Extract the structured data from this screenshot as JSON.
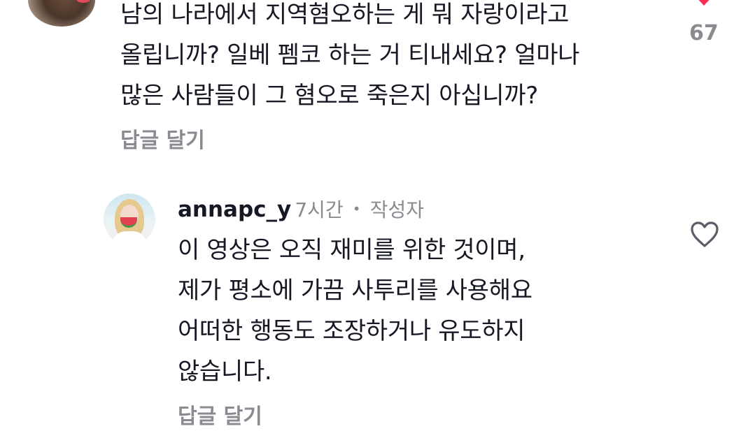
{
  "comment_1": {
    "lines": [
      "남의 나라에서 지역혐오하는 게 뭐 자랑이라고",
      "올립니까? 일베 펨코 하는 거 티내세요? 얼마나",
      "많은 사람들이 그 혐오로 죽은지 아십니까?"
    ],
    "reply_label": "답글 달기",
    "like_count": "67",
    "liked": true
  },
  "comment_2": {
    "username": "annapc_y",
    "time": "7시간",
    "separator": "•",
    "author_badge": "작성자",
    "lines": [
      "이 영상은 오직 재미를 위한 것이며,",
      "제가 평소에 가끔 사투리를 사용해요",
      "어떠한 행동도 조장하거나 유도하지",
      "않습니다."
    ],
    "reply_label": "답글 달기",
    "liked": false
  },
  "colors": {
    "text": "#161823",
    "secondary": "#8a8b91",
    "like_red": "#fe2c55",
    "outline": "#5c5d66"
  },
  "icons": {
    "liked_heart": "heart-filled-icon",
    "like_heart": "heart-outline-icon"
  }
}
